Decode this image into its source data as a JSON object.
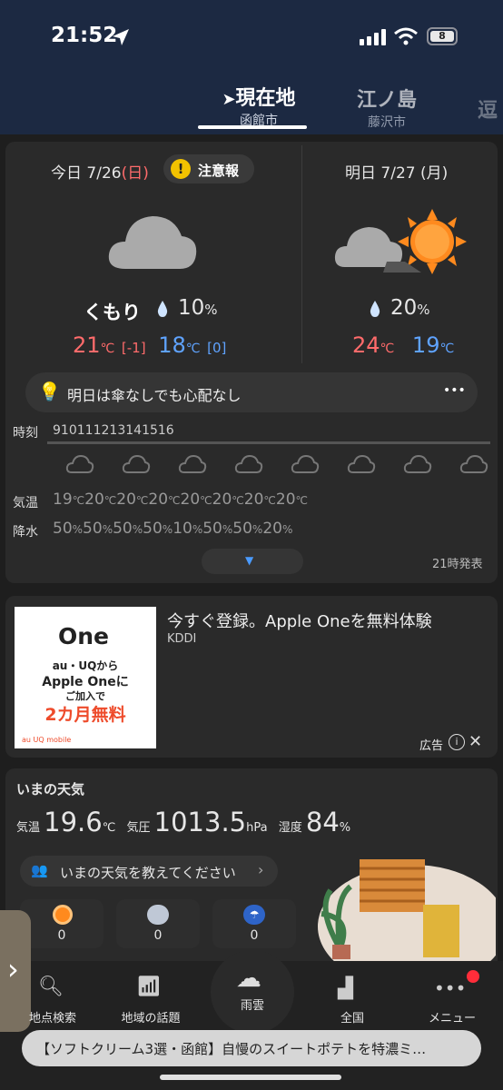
{
  "status": {
    "time": "21:52",
    "battery": "8"
  },
  "header": {
    "tabs": [
      {
        "main": "現在地",
        "sub": "函館市"
      },
      {
        "main": "江ノ島",
        "sub": "藤沢市"
      },
      {
        "main": "逗"
      }
    ]
  },
  "today": {
    "label": "今日 7/26",
    "weekday": "(日)",
    "alert": "注意報",
    "condition": "くもり",
    "rain_pct": "10",
    "pct_unit": "%",
    "high": "21",
    "high_diff": "[-1]",
    "low": "18",
    "low_diff": "[0]",
    "temp_unit": "℃"
  },
  "tomorrow": {
    "label": "明日 7/27 (月)",
    "rain_pct": "20",
    "pct_unit": "%",
    "high": "24",
    "low": "19",
    "temp_unit": "℃"
  },
  "tip": {
    "text": "明日は傘なしでも心配なし",
    "more": "•••"
  },
  "hourly": {
    "time_label": "時刻",
    "temp_label": "気温",
    "rain_label": "降水",
    "hours": [
      "9",
      "10",
      "11",
      "12",
      "13",
      "14",
      "15",
      "16"
    ],
    "temps": [
      "19",
      "20",
      "20",
      "20",
      "20",
      "20",
      "20",
      "20"
    ],
    "temp_unit": "℃",
    "rain": [
      "50",
      "50",
      "50",
      "50",
      "10",
      "50",
      "50",
      "20"
    ],
    "rain_unit": "%",
    "issued": "21時発表"
  },
  "ad": {
    "title": "今すぐ登録。Apple Oneを無料体験",
    "sponsor": "KDDI",
    "label": "広告",
    "box_logo": "One",
    "box_line1": "au・UQから",
    "box_line2": "Apple Oneに",
    "box_line3": "ご加入で",
    "box_line4": "2カ月無料",
    "box_brand": "au UQ mobile"
  },
  "now": {
    "title": "いまの天気",
    "temp_label": "気温",
    "temp": "19.6",
    "temp_unit": "℃",
    "pressure_label": "気圧",
    "pressure": "1013.5",
    "pressure_unit": "hPa",
    "humidity_label": "湿度",
    "humidity": "84",
    "humidity_unit": "%",
    "report_prompt": "いまの天気を教えてください",
    "counts": [
      "0",
      "0",
      "0"
    ]
  },
  "nav": {
    "search": "地点検索",
    "topics": "地域の話題",
    "rain": "雨雲",
    "national": "全国",
    "menu": "メニュー"
  },
  "news": {
    "text": "【ソフトクリーム3選・函館】自慢のスイートポテトを特濃ミ…"
  },
  "colors": {
    "high": "#ff6b6b",
    "low": "#5fa3ff",
    "accent": "#ff8a1e",
    "header": "#1c2942"
  }
}
